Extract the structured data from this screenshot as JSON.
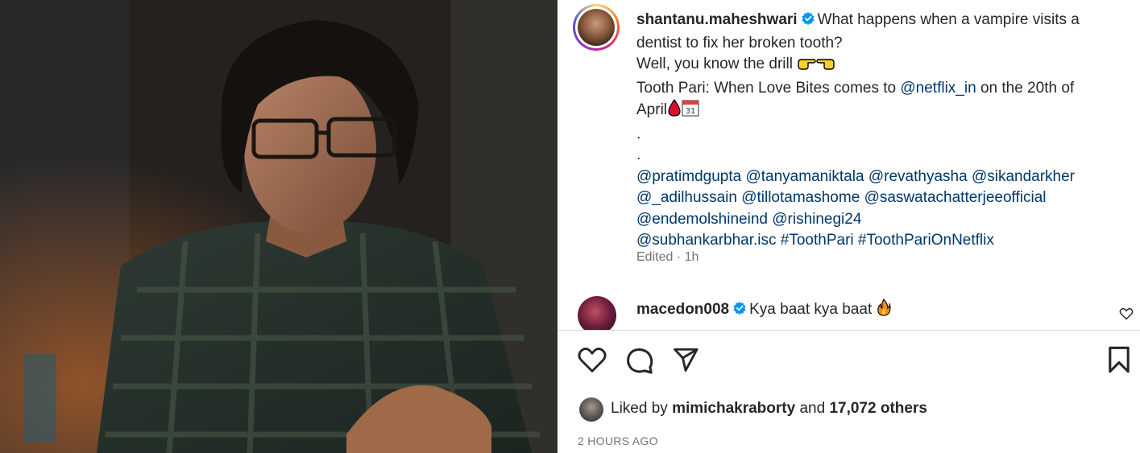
{
  "post": {
    "username": "shantanu.maheshwari",
    "caption_lines": [
      "What happens when a vampire visits a",
      "dentist to fix her broken tooth?",
      "Well, you know the drill",
      "Tooth Pari: When Love Bites comes to",
      "on the 20th of",
      "April",
      ".",
      "."
    ],
    "netflix_mention": "@netflix_in",
    "mentions_line1": [
      "@pratimdgupta",
      "@tanyamaniktala",
      "@revathyasha",
      "@sikandarkher"
    ],
    "mentions_line2": [
      "@_adilhussain",
      "@tillotamashome",
      "@saswatachatterjeeofficial"
    ],
    "mentions_line3": [
      "@endemolshineind",
      "@rishinegi24"
    ],
    "mentions_line4": [
      "@subhankarbhar.isc"
    ],
    "hashtags": [
      "#ToothPari",
      "#ToothPariOnNetflix"
    ],
    "edited_label": "Edited · 1h",
    "icons": [
      "verified-badge-icon",
      "pointing-right-icon",
      "pointing-left-icon",
      "drop-of-blood-icon",
      "calendar-icon"
    ],
    "calendar_day": "31"
  },
  "comment": {
    "username": "macedon008",
    "text": "Kya baat kya baat",
    "icons": [
      "verified-badge-icon",
      "fire-icon",
      "heart-outline-icon"
    ]
  },
  "actions": {
    "icons": [
      "heart-outline-icon",
      "comment-bubble-icon",
      "share-paper-plane-icon",
      "bookmark-icon"
    ]
  },
  "likes": {
    "prefix": "Liked by",
    "user": "mimichakraborty",
    "middle": "and",
    "count": "17,072 others"
  },
  "timestamp": "2 HOURS AGO",
  "colors": {
    "link": "#00376b",
    "verified": "#0095f6",
    "muted": "#737373",
    "text": "#262626"
  }
}
